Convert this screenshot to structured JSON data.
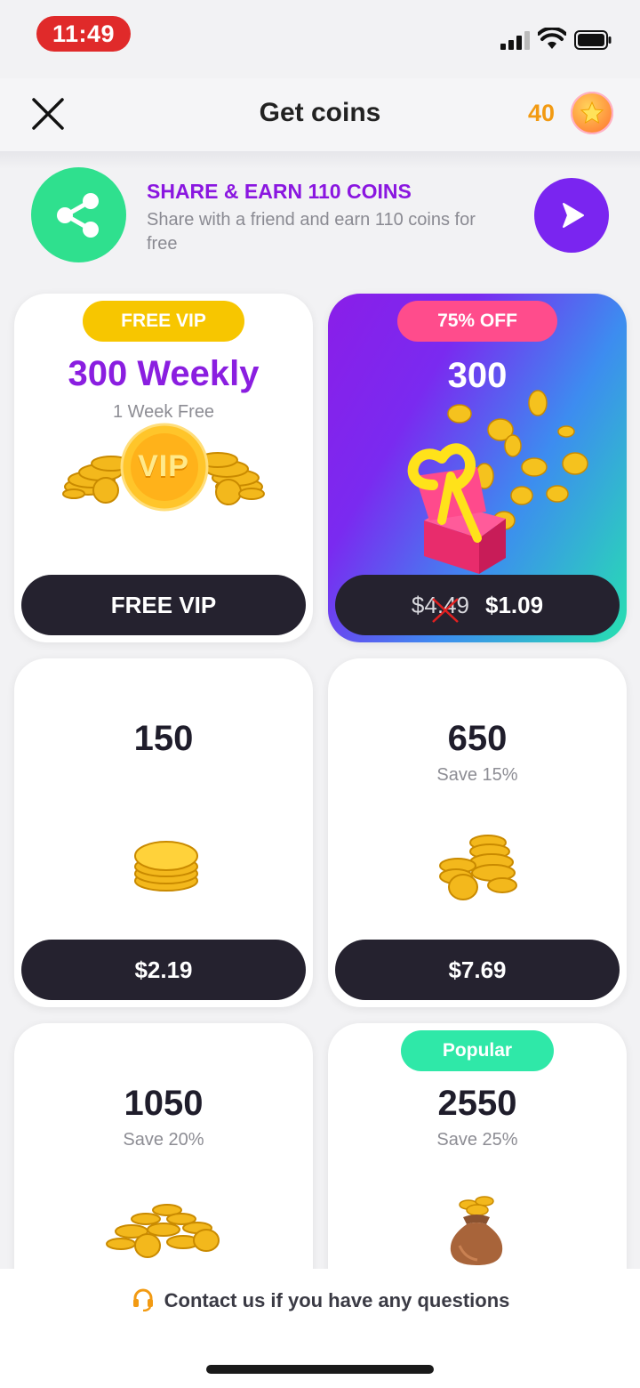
{
  "status_bar": {
    "time": "11:49",
    "time_pill_color": "#e02a2a"
  },
  "header": {
    "title": "Get coins",
    "coin_balance": "40",
    "close_icon": "close-icon",
    "coin_icon": "star-coin-icon"
  },
  "share_banner": {
    "title": "SHARE & EARN 110 COINS",
    "subtitle": "Share with a friend and earn 110 coins for free",
    "share_icon": "share-icon",
    "go_icon": "play-arrow-icon",
    "accent": "#8a16e0",
    "circle_color": "#2fe08e"
  },
  "cards": [
    {
      "badge": "FREE VIP",
      "amount": "300 Weekly",
      "sub": "1 Week Free",
      "image_text": "VIP",
      "button": "FREE VIP",
      "badge_color": "#f7c600",
      "amount_color": "#8a1ee0"
    },
    {
      "badge": "75% OFF",
      "amount": "300",
      "old_price": "$4.49",
      "button": "$1.09",
      "badge_color": "#ff4c8c"
    },
    {
      "amount": "150",
      "button": "$2.19"
    },
    {
      "amount": "650",
      "sub": "Save 15%",
      "button": "$7.69"
    },
    {
      "amount": "1050",
      "sub": "Save 20%"
    },
    {
      "badge": "Popular",
      "amount": "2550",
      "sub": "Save 25%",
      "badge_color": "#2fe8a8"
    }
  ],
  "footer": {
    "contact": "Contact us if you have any questions",
    "contact_icon": "headset-icon"
  }
}
